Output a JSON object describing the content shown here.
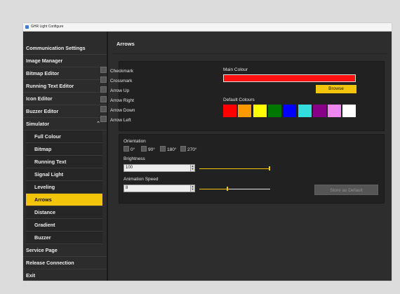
{
  "window": {
    "title": "GHR Light Configure"
  },
  "sidebar": {
    "items": [
      {
        "label": "Communication Settings"
      },
      {
        "label": "Image Manager"
      },
      {
        "label": "Bitmap Editor"
      },
      {
        "label": "Running Text Editor"
      },
      {
        "label": "Icon Editor"
      },
      {
        "label": "Buzzer Editor"
      },
      {
        "label": "Simulator",
        "expanded": true,
        "chevron_icon": "chevron-up-icon"
      },
      {
        "label": "Full Colour"
      },
      {
        "label": "Bitmap"
      },
      {
        "label": "Running Text"
      },
      {
        "label": "Signal Light"
      },
      {
        "label": "Leveling"
      },
      {
        "label": "Arrows",
        "selected": true
      },
      {
        "label": "Distance"
      },
      {
        "label": "Gradient"
      },
      {
        "label": "Buzzer"
      },
      {
        "label": "Service Page"
      },
      {
        "label": "Release Connection"
      },
      {
        "label": "Exit"
      }
    ]
  },
  "main": {
    "title": "Arrows",
    "arrows": [
      {
        "label": "Checkmark",
        "checked": false
      },
      {
        "label": "Crossmark",
        "checked": false
      },
      {
        "label": "Arrow Up",
        "checked": false
      },
      {
        "label": "Arrow Right",
        "checked": false
      },
      {
        "label": "Arrow Down",
        "checked": false
      },
      {
        "label": "Arrow Left",
        "checked": false
      }
    ],
    "main_colour_label": "Main Colour",
    "main_colour": "#ff1111",
    "browse_label": "Browse",
    "default_colours_label": "Default Colours",
    "default_colours": [
      "#ff0000",
      "#ff9900",
      "#ffff00",
      "#007700",
      "#0000ff",
      "#33dddd",
      "#880088",
      "#ee88ee",
      "#ffffff"
    ],
    "orientation_label": "Orientation",
    "orientation_options": [
      "0°",
      "90°",
      "180°",
      "270°"
    ],
    "brightness_label": "Brightness",
    "brightness_value": "100",
    "brightness_level": 1.0,
    "animation_speed_label": "Animation Speed",
    "animation_speed_value": "8",
    "animation_speed_level": 0.4,
    "store_default_label": "Store as Default"
  },
  "colors": {
    "accent": "#f2c50a"
  }
}
